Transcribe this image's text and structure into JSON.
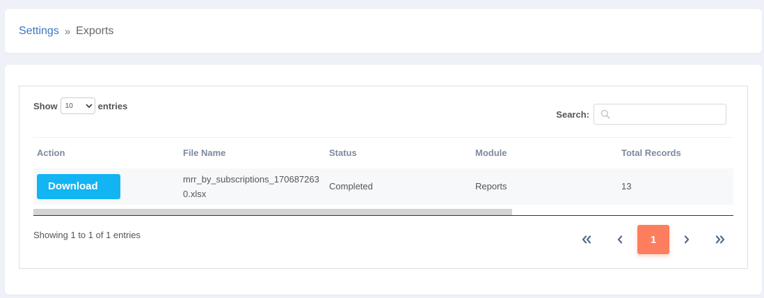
{
  "breadcrumb": {
    "parent": "Settings",
    "separator": "»",
    "current": "Exports"
  },
  "table_controls": {
    "show_label": "Show",
    "entries_label": "entries",
    "page_length": "10",
    "search_label": "Search:",
    "search_value": ""
  },
  "table": {
    "columns": [
      "Action",
      "File Name",
      "Status",
      "Module",
      "Total Records"
    ],
    "rows": [
      {
        "action_label": "Download",
        "file_name": "mrr_by_subscriptions_1706872630.xlsx",
        "status": "Completed",
        "module": "Reports",
        "total_records": "13"
      }
    ]
  },
  "footer": {
    "info": "Showing 1 to 1 of 1 entries",
    "pagination": {
      "first": "«",
      "prev": "‹",
      "current": "1",
      "next": "›",
      "last": "»"
    }
  },
  "colors": {
    "link": "#3a76c4",
    "download_button": "#12b4f2",
    "active_page": "#fd7d5f"
  },
  "icons": {
    "search": "search-icon",
    "first": "double-chevron-left-icon",
    "prev": "chevron-left-icon",
    "next": "chevron-right-icon",
    "last": "double-chevron-right-icon"
  }
}
